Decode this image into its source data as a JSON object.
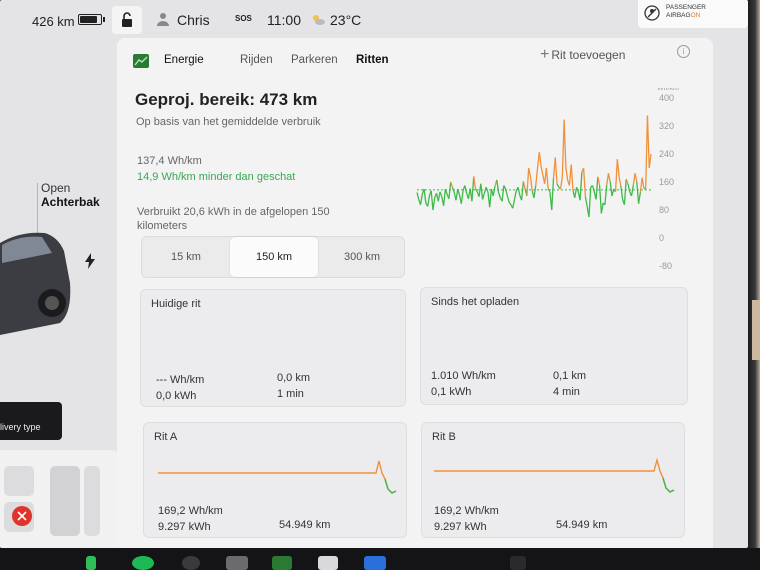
{
  "status": {
    "range": "426 km",
    "user": "Chris",
    "sos": "SOS",
    "time": "11:00",
    "temperature": "23°C",
    "airbag_line1": "PASSENGER",
    "airbag_line2": "AIRBAG",
    "airbag_line2_suffix": "ON",
    "battery_level": 0.85
  },
  "car": {
    "trunk_line1": "Open",
    "trunk_line2": "Achterbak",
    "delivery_label": "livery type"
  },
  "nav": {
    "energy": "Energie",
    "tabs": [
      "Rijden",
      "Parkeren",
      "Ritten"
    ],
    "add_trip": "Rit toevoegen",
    "info": "i"
  },
  "energy": {
    "title": "Geproj. bereik: 473 km",
    "subtitle": "Op basis van het gemiddelde verbruik",
    "avg": "137,4 Wh/km",
    "diff": "14,9 Wh/km minder dan geschat",
    "used": "Verbruikt 20,6 kWh in de afgelopen 150 kilometers",
    "ranges": [
      "15 km",
      "150 km",
      "300 km"
    ],
    "selected_range": "150 km"
  },
  "chart_data": {
    "type": "line",
    "ylabel_unit": "Wh/km",
    "yticks": [
      "400",
      "320",
      "240",
      "160",
      "80",
      "0",
      "-80"
    ],
    "ylim": [
      -80,
      400
    ],
    "reference_line": 137.4,
    "colors": {
      "above": "#f0913a",
      "below": "#3dba48",
      "reference": "#3dba48"
    },
    "values": [
      130,
      110,
      95,
      125,
      140,
      100,
      90,
      120,
      135,
      80,
      115,
      128,
      105,
      132,
      118,
      92,
      140,
      125,
      112,
      160,
      145,
      130,
      108,
      140,
      122,
      98,
      136,
      150,
      128,
      112,
      141,
      105,
      176,
      140,
      132,
      118,
      155,
      110,
      128,
      145,
      132,
      88,
      140,
      120,
      148,
      166,
      130,
      115,
      105,
      150,
      140,
      120,
      102,
      95,
      85,
      110,
      135,
      145,
      122,
      108,
      162,
      140,
      120,
      200,
      175,
      135,
      115,
      150,
      200,
      245,
      205,
      180,
      155,
      200,
      140,
      132,
      80,
      170,
      230,
      155,
      145,
      140,
      176,
      338,
      200,
      165,
      150,
      210,
      135,
      115,
      145,
      132,
      108,
      188,
      200,
      118,
      90,
      60,
      145,
      150,
      132,
      110,
      175,
      150,
      70,
      100,
      95,
      150,
      185,
      160,
      120,
      140,
      132,
      225,
      175,
      148,
      110,
      95,
      168,
      155,
      132,
      120,
      150,
      185,
      160,
      98,
      130,
      172,
      142,
      140,
      350,
      200,
      240
    ]
  },
  "tiles": {
    "current_trip": {
      "title": "Huidige rit",
      "wh_per_km": "--- Wh/km",
      "km": "0,0 km",
      "kwh": "0,0 kWh",
      "duration": "1 min"
    },
    "since_charge": {
      "title": "Sinds het opladen",
      "wh_per_km": "1.010 Wh/km",
      "km": "0,1 km",
      "kwh": "0,1 kWh",
      "duration": "4 min"
    },
    "trip_a": {
      "title": "Rit A",
      "wh_per_km": "169,2 Wh/km",
      "kwh": "9.297 kWh",
      "km": "54.949 km"
    },
    "trip_b": {
      "title": "Rit B",
      "wh_per_km": "169,2 Wh/km",
      "kwh": "9.297 kWh",
      "km": "54.949 km"
    }
  }
}
